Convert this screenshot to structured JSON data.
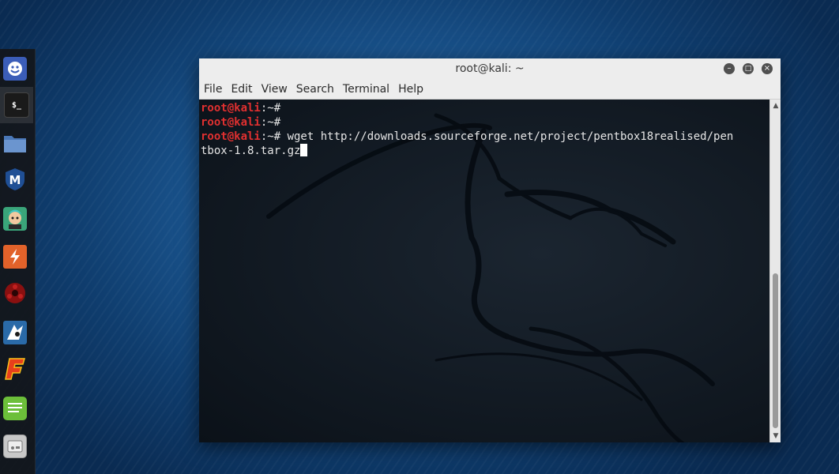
{
  "window": {
    "title": "root@kali: ~",
    "buttons": {
      "minimize": "–",
      "maximize": "□",
      "close": "×"
    }
  },
  "menu": {
    "items": [
      "File",
      "Edit",
      "View",
      "Search",
      "Terminal",
      "Help"
    ]
  },
  "terminal": {
    "lines": [
      {
        "user": "root@kali",
        "path": ":~",
        "symbol": "# ",
        "command": ""
      },
      {
        "user": "root@kali",
        "path": ":~",
        "symbol": "# ",
        "command": ""
      },
      {
        "user": "root@kali",
        "path": ":~",
        "symbol": "# ",
        "command": "wget http://downloads.sourceforge.net/project/pentbox18realised/pen"
      }
    ],
    "wrapped_continuation": "tbox-1.8.tar.gz"
  },
  "dock": {
    "items": [
      {
        "icon": "crowd-icon",
        "color": "#3b5db8"
      },
      {
        "icon": "terminal-icon",
        "color": "#1a1a1a",
        "glyph": "$_"
      },
      {
        "icon": "folder-icon",
        "color": "#4a78b8"
      },
      {
        "icon": "metasploit-icon",
        "color": "#1f4f95",
        "glyph": "M"
      },
      {
        "icon": "armitage-icon",
        "color": "#3aa57a"
      },
      {
        "icon": "burpsuite-icon",
        "color": "#e2622a"
      },
      {
        "icon": "faraday-icon",
        "color": "#8a1010"
      },
      {
        "icon": "beef-icon",
        "color": "#2a6aa8"
      },
      {
        "icon": "maltego-icon",
        "color": "#e8401c",
        "glyph": "F"
      },
      {
        "icon": "notes-icon",
        "color": "#6cbf3a"
      },
      {
        "icon": "app-grid-icon",
        "color": "#c8c8c8"
      }
    ]
  },
  "colors": {
    "prompt_user": "#e03030",
    "terminal_bg": "#121a23",
    "titlebar_bg": "#ededed"
  }
}
